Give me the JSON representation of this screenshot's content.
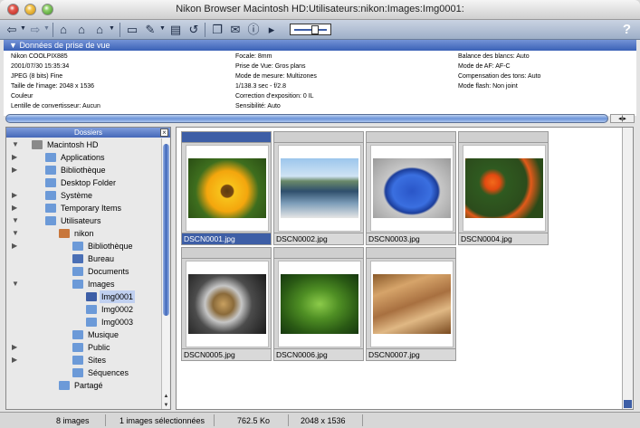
{
  "window": {
    "title": "Nikon Browser Macintosh HD:Utilisateurs:nikon:Images:Img0001:"
  },
  "toolbar": {
    "buttons": [
      "back-icon",
      "forward-icon",
      "new-folder-icon",
      "camera-folder-icon",
      "open-folder-icon",
      "folder-icon",
      "edit-icon",
      "print-icon",
      "rotate-icon",
      "copy-icon",
      "mail-icon",
      "info-icon"
    ],
    "help_label": "?"
  },
  "metadata": {
    "header": "Données de prise de vue",
    "col1": [
      "Nikon COOLPIX885",
      "2001/07/30 15:35:34",
      "JPEG (8 bits) Fine",
      "Taille de l'image: 2048 x 1536",
      "Couleur",
      "Lentille de convertisseur: Aucun"
    ],
    "col2": [
      "Focale: 8mm",
      "Prise de Vue:  Gros plans",
      "Mode de mesure: Multizones",
      "1/138.3 sec - f/2.8",
      "Correction d'exposition: 0 IL",
      "Sensibilité: Auto"
    ],
    "col3": [
      "Balance des blancs: Auto",
      "Mode de AF: AF-C",
      "Compensation des tons: Auto",
      "Mode flash: Non joint"
    ]
  },
  "tree": {
    "header": "Dossiers",
    "items": [
      {
        "label": "Macintosh HD",
        "indent": 0,
        "tri": "down",
        "icon": "hard-drive-icon",
        "color": "#8a8a8a"
      },
      {
        "label": "Applications",
        "indent": 1,
        "tri": "right",
        "icon": "folder-icon",
        "color": "#6c9ad8"
      },
      {
        "label": "Bibliothèque",
        "indent": 1,
        "tri": "right",
        "icon": "folder-icon",
        "color": "#6c9ad8"
      },
      {
        "label": "Desktop Folder",
        "indent": 1,
        "tri": "",
        "icon": "folder-icon",
        "color": "#6c9ad8"
      },
      {
        "label": "Système",
        "indent": 1,
        "tri": "right",
        "icon": "folder-icon",
        "color": "#6c9ad8"
      },
      {
        "label": "Temporary Items",
        "indent": 1,
        "tri": "right",
        "icon": "folder-icon",
        "color": "#6c9ad8"
      },
      {
        "label": "Utilisateurs",
        "indent": 1,
        "tri": "down",
        "icon": "folder-icon",
        "color": "#6c9ad8"
      },
      {
        "label": "nikon",
        "indent": 2,
        "tri": "down",
        "icon": "home-icon",
        "color": "#c8773c"
      },
      {
        "label": "Bibliothèque",
        "indent": 3,
        "tri": "right",
        "icon": "folder-icon",
        "color": "#6c9ad8"
      },
      {
        "label": "Bureau",
        "indent": 3,
        "tri": "",
        "icon": "folder-icon",
        "color": "#4a6fb5"
      },
      {
        "label": "Documents",
        "indent": 3,
        "tri": "",
        "icon": "folder-icon",
        "color": "#6c9ad8"
      },
      {
        "label": "Images",
        "indent": 3,
        "tri": "down",
        "icon": "folder-icon",
        "color": "#6c9ad8"
      },
      {
        "label": "Img0001",
        "indent": 4,
        "tri": "",
        "icon": "folder-icon",
        "color": "#3d5ea6",
        "selected": true
      },
      {
        "label": "Img0002",
        "indent": 4,
        "tri": "",
        "icon": "folder-icon",
        "color": "#6c9ad8"
      },
      {
        "label": "Img0003",
        "indent": 4,
        "tri": "",
        "icon": "folder-icon",
        "color": "#6c9ad8"
      },
      {
        "label": "Musique",
        "indent": 3,
        "tri": "",
        "icon": "folder-icon",
        "color": "#6c9ad8"
      },
      {
        "label": "Public",
        "indent": 3,
        "tri": "right",
        "icon": "folder-icon",
        "color": "#6c9ad8"
      },
      {
        "label": "Sites",
        "indent": 3,
        "tri": "right",
        "icon": "folder-icon",
        "color": "#6c9ad8"
      },
      {
        "label": "Séquences",
        "indent": 3,
        "tri": "",
        "icon": "folder-icon",
        "color": "#6c9ad8"
      },
      {
        "label": "Partagé",
        "indent": 2,
        "tri": "",
        "icon": "folder-icon",
        "color": "#6c9ad8"
      }
    ]
  },
  "thumbnails": [
    {
      "name": "DSCN0001.jpg",
      "selected": true,
      "subject": "sunflower"
    },
    {
      "name": "DSCN0002.jpg",
      "selected": false,
      "subject": "lake"
    },
    {
      "name": "DSCN0003.jpg",
      "selected": false,
      "subject": "blue-bowl"
    },
    {
      "name": "DSCN0004.jpg",
      "selected": false,
      "subject": "orange-flowers"
    },
    {
      "name": "DSCN0005.jpg",
      "selected": false,
      "subject": "watch-movement"
    },
    {
      "name": "DSCN0006.jpg",
      "selected": false,
      "subject": "leaf-droplet"
    },
    {
      "name": "DSCN0007.jpg",
      "selected": false,
      "subject": "wheat"
    }
  ],
  "status": {
    "count": "8 images",
    "selected": "1 images sélectionnées",
    "size": "762.5 Ko",
    "dimensions": "2048 x 1536"
  },
  "colors": {
    "selection": "#3d5ea6",
    "header_blue": "#4568b8"
  }
}
